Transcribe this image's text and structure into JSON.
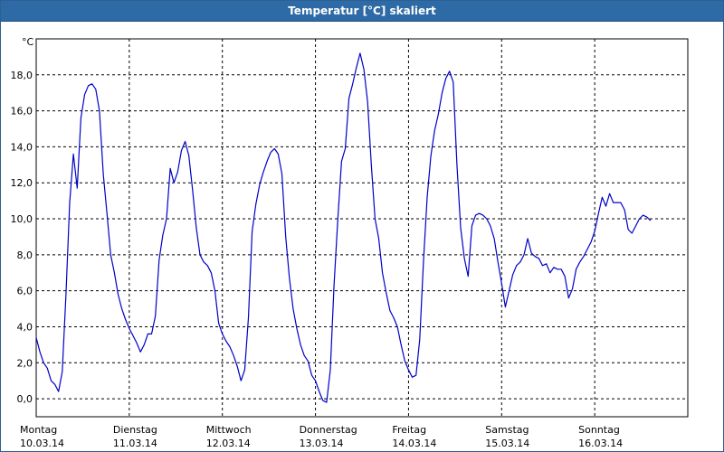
{
  "window": {
    "title": "Temperatur [°C] skaliert"
  },
  "chart_data": {
    "type": "line",
    "title": "Temperatur [°C] skaliert",
    "ylabel": "°C",
    "xlabel": "",
    "ylim": [
      -1.0,
      20.0
    ],
    "y_ticks": [
      "0,0",
      "2,0",
      "4,0",
      "6,0",
      "8,0",
      "10,0",
      "12,0",
      "14,0",
      "16,0",
      "18,0"
    ],
    "y_tick_values": [
      0,
      2,
      4,
      6,
      8,
      10,
      12,
      14,
      16,
      18
    ],
    "x_range": [
      0,
      7
    ],
    "x_day_labels": [
      {
        "day": "Montag",
        "date": "10.03.14"
      },
      {
        "day": "Dienstag",
        "date": "11.03.14"
      },
      {
        "day": "Mittwoch",
        "date": "12.03.14"
      },
      {
        "day": "Donnerstag",
        "date": "13.03.14"
      },
      {
        "day": "Freitag",
        "date": "14.03.14"
      },
      {
        "day": "Samstag",
        "date": "15.03.14"
      },
      {
        "day": "Sonntag",
        "date": "16.03.14"
      }
    ],
    "grid": true,
    "line_color": "#0000c8",
    "series": [
      {
        "points": [
          [
            0.0,
            3.4
          ],
          [
            0.04,
            2.6
          ],
          [
            0.08,
            2.0
          ],
          [
            0.12,
            1.7
          ],
          [
            0.16,
            1.0
          ],
          [
            0.2,
            0.8
          ],
          [
            0.24,
            0.4
          ],
          [
            0.28,
            1.5
          ],
          [
            0.32,
            5.8
          ],
          [
            0.36,
            10.9
          ],
          [
            0.4,
            13.6
          ],
          [
            0.44,
            11.7
          ],
          [
            0.48,
            15.6
          ],
          [
            0.52,
            16.9
          ],
          [
            0.56,
            17.4
          ],
          [
            0.6,
            17.5
          ],
          [
            0.64,
            17.2
          ],
          [
            0.68,
            16.0
          ],
          [
            0.72,
            12.5
          ],
          [
            0.76,
            10.3
          ],
          [
            0.8,
            8.0
          ],
          [
            0.84,
            7.0
          ],
          [
            0.88,
            5.8
          ],
          [
            0.92,
            5.0
          ],
          [
            0.96,
            4.4
          ],
          [
            1.0,
            3.9
          ],
          [
            1.04,
            3.5
          ],
          [
            1.08,
            3.1
          ],
          [
            1.12,
            2.6
          ],
          [
            1.16,
            3.0
          ],
          [
            1.2,
            3.6
          ],
          [
            1.24,
            3.6
          ],
          [
            1.28,
            4.6
          ],
          [
            1.32,
            7.7
          ],
          [
            1.36,
            9.1
          ],
          [
            1.4,
            10.0
          ],
          [
            1.44,
            12.8
          ],
          [
            1.48,
            12.0
          ],
          [
            1.52,
            12.6
          ],
          [
            1.56,
            13.8
          ],
          [
            1.6,
            14.3
          ],
          [
            1.64,
            13.5
          ],
          [
            1.68,
            11.6
          ],
          [
            1.72,
            9.5
          ],
          [
            1.76,
            8.0
          ],
          [
            1.8,
            7.6
          ],
          [
            1.84,
            7.4
          ],
          [
            1.88,
            7.0
          ],
          [
            1.92,
            6.0
          ],
          [
            1.96,
            4.2
          ],
          [
            2.0,
            3.6
          ],
          [
            2.04,
            3.2
          ],
          [
            2.08,
            2.9
          ],
          [
            2.12,
            2.4
          ],
          [
            2.16,
            1.8
          ],
          [
            2.2,
            1.0
          ],
          [
            2.24,
            1.6
          ],
          [
            2.28,
            4.5
          ],
          [
            2.32,
            9.3
          ],
          [
            2.36,
            10.8
          ],
          [
            2.4,
            11.9
          ],
          [
            2.44,
            12.6
          ],
          [
            2.48,
            13.2
          ],
          [
            2.52,
            13.7
          ],
          [
            2.56,
            13.9
          ],
          [
            2.6,
            13.6
          ],
          [
            2.64,
            12.5
          ],
          [
            2.68,
            9.0
          ],
          [
            2.72,
            6.7
          ],
          [
            2.76,
            5.0
          ],
          [
            2.8,
            3.9
          ],
          [
            2.84,
            3.0
          ],
          [
            2.88,
            2.4
          ],
          [
            2.92,
            2.1
          ],
          [
            2.96,
            1.3
          ],
          [
            3.0,
            1.0
          ],
          [
            3.04,
            0.4
          ],
          [
            3.08,
            -0.1
          ],
          [
            3.12,
            -0.2
          ],
          [
            3.16,
            1.6
          ],
          [
            3.2,
            6.3
          ],
          [
            3.24,
            10.0
          ],
          [
            3.28,
            13.2
          ],
          [
            3.32,
            13.9
          ],
          [
            3.36,
            16.7
          ],
          [
            3.4,
            17.5
          ],
          [
            3.44,
            18.4
          ],
          [
            3.48,
            19.2
          ],
          [
            3.52,
            18.3
          ],
          [
            3.56,
            16.5
          ],
          [
            3.6,
            13.0
          ],
          [
            3.64,
            10.0
          ],
          [
            3.68,
            8.9
          ],
          [
            3.72,
            7.0
          ],
          [
            3.76,
            5.9
          ],
          [
            3.8,
            4.9
          ],
          [
            3.84,
            4.5
          ],
          [
            3.88,
            4.0
          ],
          [
            3.92,
            3.0
          ],
          [
            3.96,
            2.1
          ],
          [
            4.0,
            1.6
          ],
          [
            4.04,
            1.2
          ],
          [
            4.08,
            1.3
          ],
          [
            4.12,
            3.3
          ],
          [
            4.16,
            7.6
          ],
          [
            4.2,
            11.2
          ],
          [
            4.24,
            13.5
          ],
          [
            4.28,
            14.9
          ],
          [
            4.32,
            15.8
          ],
          [
            4.36,
            17.0
          ],
          [
            4.4,
            17.8
          ],
          [
            4.44,
            18.2
          ],
          [
            4.48,
            17.6
          ],
          [
            4.52,
            13.0
          ],
          [
            4.56,
            9.5
          ],
          [
            4.6,
            7.8
          ],
          [
            4.64,
            6.8
          ],
          [
            4.68,
            9.6
          ],
          [
            4.72,
            10.2
          ],
          [
            4.76,
            10.3
          ],
          [
            4.8,
            10.2
          ],
          [
            4.84,
            10.0
          ],
          [
            4.88,
            9.6
          ],
          [
            4.92,
            8.9
          ],
          [
            4.96,
            7.6
          ],
          [
            5.0,
            6.4
          ],
          [
            5.04,
            5.1
          ],
          [
            5.08,
            6.0
          ],
          [
            5.12,
            6.9
          ],
          [
            5.16,
            7.4
          ],
          [
            5.2,
            7.6
          ],
          [
            5.24,
            8.0
          ],
          [
            5.28,
            8.9
          ],
          [
            5.32,
            8.1
          ],
          [
            5.36,
            7.9
          ],
          [
            5.4,
            7.8
          ],
          [
            5.44,
            7.4
          ],
          [
            5.48,
            7.5
          ],
          [
            5.52,
            7.0
          ],
          [
            5.56,
            7.3
          ],
          [
            5.6,
            7.2
          ],
          [
            5.64,
            7.2
          ],
          [
            5.68,
            6.8
          ],
          [
            5.72,
            5.6
          ],
          [
            5.76,
            6.1
          ],
          [
            5.8,
            7.2
          ],
          [
            5.84,
            7.6
          ],
          [
            5.88,
            7.9
          ],
          [
            5.92,
            8.3
          ],
          [
            5.96,
            8.7
          ],
          [
            6.0,
            9.3
          ],
          [
            6.04,
            10.3
          ],
          [
            6.08,
            11.2
          ],
          [
            6.12,
            10.7
          ],
          [
            6.16,
            11.4
          ],
          [
            6.2,
            10.9
          ],
          [
            6.24,
            10.9
          ],
          [
            6.28,
            10.9
          ],
          [
            6.32,
            10.5
          ],
          [
            6.36,
            9.4
          ],
          [
            6.4,
            9.2
          ],
          [
            6.44,
            9.6
          ],
          [
            6.48,
            10.0
          ],
          [
            6.52,
            10.2
          ],
          [
            6.56,
            10.1
          ],
          [
            6.6,
            9.9
          ]
        ]
      }
    ]
  }
}
